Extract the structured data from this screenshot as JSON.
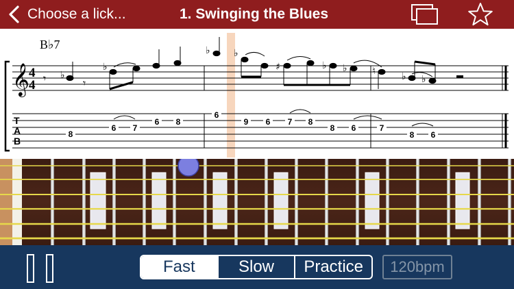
{
  "nav": {
    "back_label": "Choose a lick...",
    "title": "1. Swinging the Blues"
  },
  "score": {
    "chord": "B♭7",
    "time_signature_top": "4",
    "time_signature_bottom": "4",
    "tab_letters": [
      "T",
      "A",
      "B"
    ],
    "tab_numbers": [
      "8",
      "6",
      "7",
      "6",
      "8",
      "6",
      "9",
      "6",
      "7",
      "8",
      "8",
      "6",
      "7",
      "8",
      "6"
    ]
  },
  "controls": {
    "speed_options": [
      "Fast",
      "Slow",
      "Practice"
    ],
    "selected_speed": "Fast",
    "tempo": "120bpm"
  },
  "colors": {
    "header": "#8f1d1e",
    "bottom_bar": "#17375e",
    "playhead": "#f7d6bd",
    "fret_marker_dot": "#7c7fe0"
  }
}
